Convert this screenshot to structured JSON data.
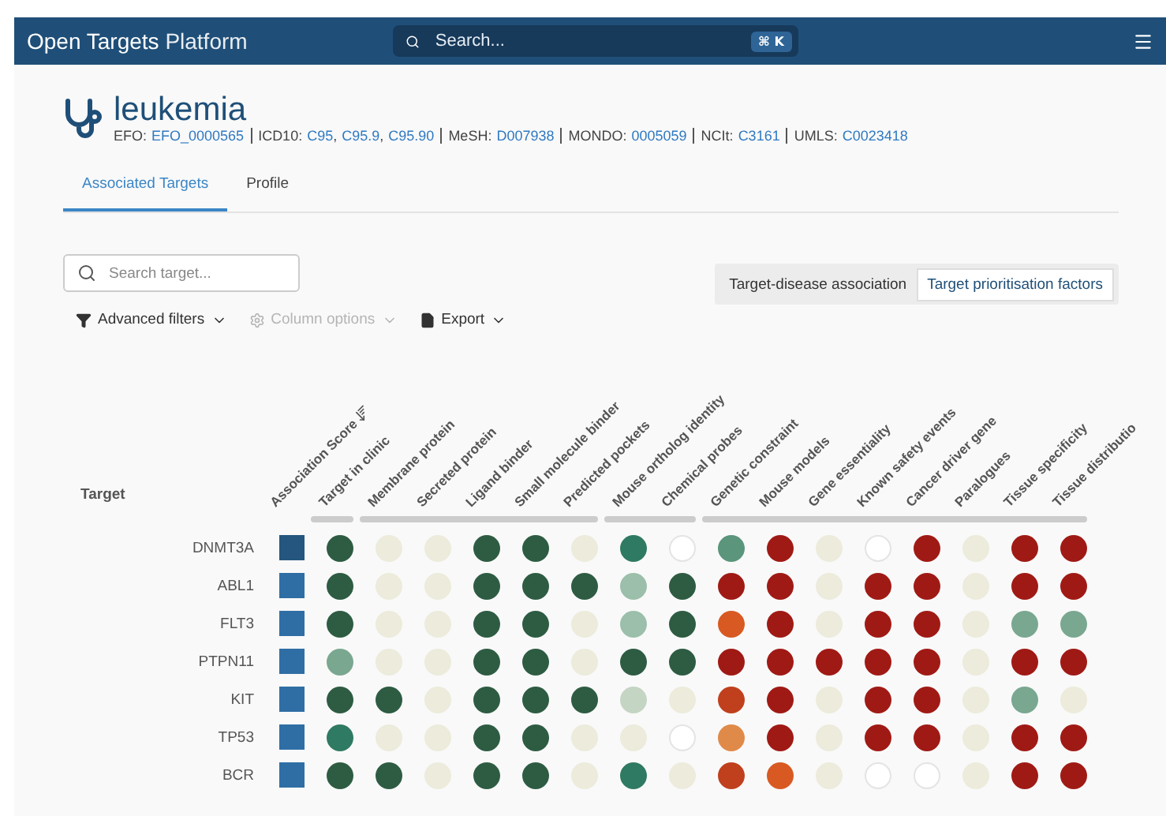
{
  "header": {
    "brand_bold": "Open Targets",
    "brand_light": "Platform",
    "search": {
      "placeholder": "Search...",
      "shortcut": "⌘ K"
    }
  },
  "disease": {
    "name": "leukemia",
    "xrefs": [
      {
        "label": "EFO:",
        "ids": [
          "EFO_0000565"
        ]
      },
      {
        "label": "ICD10:",
        "ids": [
          "C95",
          "C95.9",
          "C95.90"
        ],
        "separator": ","
      },
      {
        "label": "MeSH:",
        "ids": [
          "D007938"
        ]
      },
      {
        "label": "MONDO:",
        "ids": [
          "0005059"
        ]
      },
      {
        "label": "NCIt:",
        "ids": [
          "C3161"
        ]
      },
      {
        "label": "UMLS:",
        "ids": [
          "C0023418"
        ]
      }
    ]
  },
  "tabs": [
    {
      "label": "Associated Targets",
      "selected": true
    },
    {
      "label": "Profile",
      "selected": false
    }
  ],
  "target_search": {
    "placeholder": "Search target..."
  },
  "toolbar": [
    {
      "label": "Advanced filters",
      "kind": "filter",
      "disabled": false
    },
    {
      "label": "Column options",
      "kind": "gear",
      "disabled": true
    },
    {
      "label": "Export",
      "kind": "file",
      "disabled": false
    }
  ],
  "view_toggle": [
    {
      "label": "Target-disease association",
      "selected": false
    },
    {
      "label": "Target prioritisation factors",
      "selected": true
    }
  ],
  "table": {
    "target_heading": "Target",
    "score_heading": "Association Score",
    "column_groups": [
      {
        "columns": [
          "Target in clinic"
        ]
      },
      {
        "columns": [
          "Membrane protein",
          "Secreted protein",
          "Ligand binder",
          "Small molecule binder",
          "Predicted pockets"
        ]
      },
      {
        "columns": [
          "Mouse ortholog identity",
          "Chemical probes"
        ]
      },
      {
        "columns": [
          "Genetic constraint",
          "Mouse models",
          "Gene essentiality",
          "Known safety events",
          "Cancer driver gene",
          "Paralogues",
          "Tissue specificity",
          "Tissue distributio"
        ]
      }
    ],
    "rows": [
      {
        "target": "DNMT3A",
        "score": {
          "color": "#24567f"
        },
        "cells": [
          {
            "color": "#2e5c43"
          },
          {
            "color": "#ecebdc"
          },
          {
            "color": "#ecebdc"
          },
          {
            "color": "#2e5c43"
          },
          {
            "color": "#2e5c43"
          },
          {
            "color": "#ecebdc"
          },
          {
            "color": "#2f7a62"
          },
          {
            "color": "#ffffff"
          },
          {
            "color": "#5a957c"
          },
          {
            "color": "#a01a15"
          },
          {
            "color": "#ecebdc"
          },
          {
            "color": "#ffffff"
          },
          {
            "color": "#a01a15"
          },
          {
            "color": "#ecebdc"
          },
          {
            "color": "#a01a15"
          },
          {
            "color": "#a01a15"
          }
        ]
      },
      {
        "target": "ABL1",
        "score": {
          "color": "#2f6ea5"
        },
        "cells": [
          {
            "color": "#2e5c43"
          },
          {
            "color": "#ecebdc"
          },
          {
            "color": "#ecebdc"
          },
          {
            "color": "#2e5c43"
          },
          {
            "color": "#2e5c43"
          },
          {
            "color": "#2e5c43"
          },
          {
            "color": "#9bbfaa"
          },
          {
            "color": "#2e5c43"
          },
          {
            "color": "#a01a15"
          },
          {
            "color": "#a01a15"
          },
          {
            "color": "#ecebdc"
          },
          {
            "color": "#a01a15"
          },
          {
            "color": "#a01a15"
          },
          {
            "color": "#ecebdc"
          },
          {
            "color": "#a01a15"
          },
          {
            "color": "#a01a15"
          }
        ]
      },
      {
        "target": "FLT3",
        "score": {
          "color": "#2f6ea5"
        },
        "cells": [
          {
            "color": "#2e5c43"
          },
          {
            "color": "#ecebdc"
          },
          {
            "color": "#ecebdc"
          },
          {
            "color": "#2e5c43"
          },
          {
            "color": "#2e5c43"
          },
          {
            "color": "#ecebdc"
          },
          {
            "color": "#9bbfaa"
          },
          {
            "color": "#2e5c43"
          },
          {
            "color": "#d85a22"
          },
          {
            "color": "#a01a15"
          },
          {
            "color": "#ecebdc"
          },
          {
            "color": "#a01a15"
          },
          {
            "color": "#a01a15"
          },
          {
            "color": "#ecebdc"
          },
          {
            "color": "#7aa790"
          },
          {
            "color": "#7aa790"
          }
        ]
      },
      {
        "target": "PTPN11",
        "score": {
          "color": "#2f6ea5"
        },
        "cells": [
          {
            "color": "#7aa790"
          },
          {
            "color": "#ecebdc"
          },
          {
            "color": "#ecebdc"
          },
          {
            "color": "#2e5c43"
          },
          {
            "color": "#2e5c43"
          },
          {
            "color": "#ecebdc"
          },
          {
            "color": "#2e5c43"
          },
          {
            "color": "#2e5c43"
          },
          {
            "color": "#a01a15"
          },
          {
            "color": "#a01a15"
          },
          {
            "color": "#a01a15"
          },
          {
            "color": "#a01a15"
          },
          {
            "color": "#a01a15"
          },
          {
            "color": "#ecebdc"
          },
          {
            "color": "#a01a15"
          },
          {
            "color": "#a01a15"
          }
        ]
      },
      {
        "target": "KIT",
        "score": {
          "color": "#2f6ea5"
        },
        "cells": [
          {
            "color": "#2e5c43"
          },
          {
            "color": "#2e5c43"
          },
          {
            "color": "#ecebdc"
          },
          {
            "color": "#2e5c43"
          },
          {
            "color": "#2e5c43"
          },
          {
            "color": "#2e5c43"
          },
          {
            "color": "#c5d5c3"
          },
          {
            "color": "#ecebdc"
          },
          {
            "color": "#c0401e"
          },
          {
            "color": "#a01a15"
          },
          {
            "color": "#ecebdc"
          },
          {
            "color": "#a01a15"
          },
          {
            "color": "#a01a15"
          },
          {
            "color": "#ecebdc"
          },
          {
            "color": "#7aa790"
          },
          {
            "color": "#ecebdc"
          }
        ]
      },
      {
        "target": "TP53",
        "score": {
          "color": "#2f6ea5"
        },
        "cells": [
          {
            "color": "#2f7a62"
          },
          {
            "color": "#ecebdc"
          },
          {
            "color": "#ecebdc"
          },
          {
            "color": "#2e5c43"
          },
          {
            "color": "#2e5c43"
          },
          {
            "color": "#ecebdc"
          },
          {
            "color": "#ecebdc"
          },
          {
            "color": "#ffffff"
          },
          {
            "color": "#e08a4a"
          },
          {
            "color": "#a01a15"
          },
          {
            "color": "#ecebdc"
          },
          {
            "color": "#a01a15"
          },
          {
            "color": "#a01a15"
          },
          {
            "color": "#ecebdc"
          },
          {
            "color": "#a01a15"
          },
          {
            "color": "#a01a15"
          }
        ]
      },
      {
        "target": "BCR",
        "score": {
          "color": "#2f6ea5"
        },
        "cells": [
          {
            "color": "#2e5c43"
          },
          {
            "color": "#2e5c43"
          },
          {
            "color": "#ecebdc"
          },
          {
            "color": "#2e5c43"
          },
          {
            "color": "#2e5c43"
          },
          {
            "color": "#ecebdc"
          },
          {
            "color": "#2f7a62"
          },
          {
            "color": "#ecebdc"
          },
          {
            "color": "#c0401e"
          },
          {
            "color": "#d85a22"
          },
          {
            "color": "#ecebdc"
          },
          {
            "color": "#ffffff"
          },
          {
            "color": "#ffffff"
          },
          {
            "color": "#ecebdc"
          },
          {
            "color": "#a01a15"
          },
          {
            "color": "#a01a15"
          }
        ]
      }
    ]
  }
}
